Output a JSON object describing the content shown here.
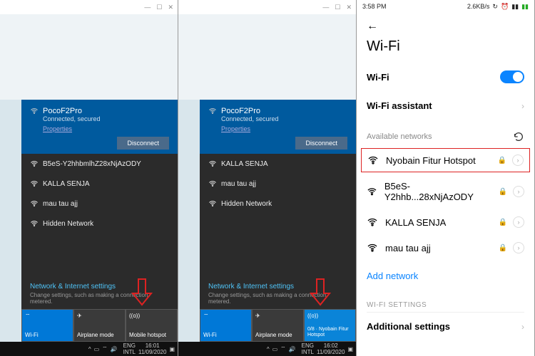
{
  "win_left": {
    "connected_ssid": "PocoF2Pro",
    "connected_status": "Connected, secured",
    "properties_label": "Properties",
    "disconnect_label": "Disconnect",
    "networks": [
      "B5eS-Y2hhbmlhZ28xNjAzODY",
      "KALLA SENJA",
      "mau tau ajj",
      "Hidden Network"
    ],
    "settings_title": "Network & Internet settings",
    "settings_sub": "Change settings, such as making a connection metered.",
    "tiles": [
      {
        "label": "Wi-Fi",
        "state": "on"
      },
      {
        "label": "Airplane mode",
        "state": "off"
      },
      {
        "label": "Mobile hotspot",
        "state": "off"
      }
    ],
    "taskbar": {
      "lang1": "ENG",
      "lang2": "INTL",
      "time": "16:01",
      "date": "11/09/2020"
    }
  },
  "win_right": {
    "connected_ssid": "PocoF2Pro",
    "connected_status": "Connected, secured",
    "properties_label": "Properties",
    "disconnect_label": "Disconnect",
    "networks": [
      "KALLA SENJA",
      "mau tau ajj",
      "Hidden Network"
    ],
    "settings_title": "Network & Internet settings",
    "settings_sub": "Change settings, such as making a connection metered.",
    "tiles": [
      {
        "label": "Wi-Fi",
        "state": "on"
      },
      {
        "label": "Airplane mode",
        "state": "off"
      },
      {
        "label": "0/8 · Nyobain Fitur Hotspot",
        "state": "highlight"
      }
    ],
    "taskbar": {
      "lang1": "ENG",
      "lang2": "INTL",
      "time": "16:02",
      "date": "11/09/2020"
    }
  },
  "phone": {
    "status_time": "3:58 PM",
    "status_speed": "2.6KB/s",
    "title": "Wi-Fi",
    "wifi_row": "Wi-Fi",
    "assistant_row": "Wi-Fi assistant",
    "available_label": "Available networks",
    "networks": [
      {
        "name": "Nyobain Fitur Hotspot",
        "locked": true,
        "hl": true
      },
      {
        "name": "B5eS-Y2hhb...28xNjAzODY",
        "locked": true,
        "hl": false
      },
      {
        "name": "KALLA SENJA",
        "locked": true,
        "hl": false
      },
      {
        "name": "mau tau ajj",
        "locked": true,
        "hl": false
      }
    ],
    "add_network": "Add network",
    "section_label": "WI-FI SETTINGS",
    "additional": "Additional settings"
  }
}
